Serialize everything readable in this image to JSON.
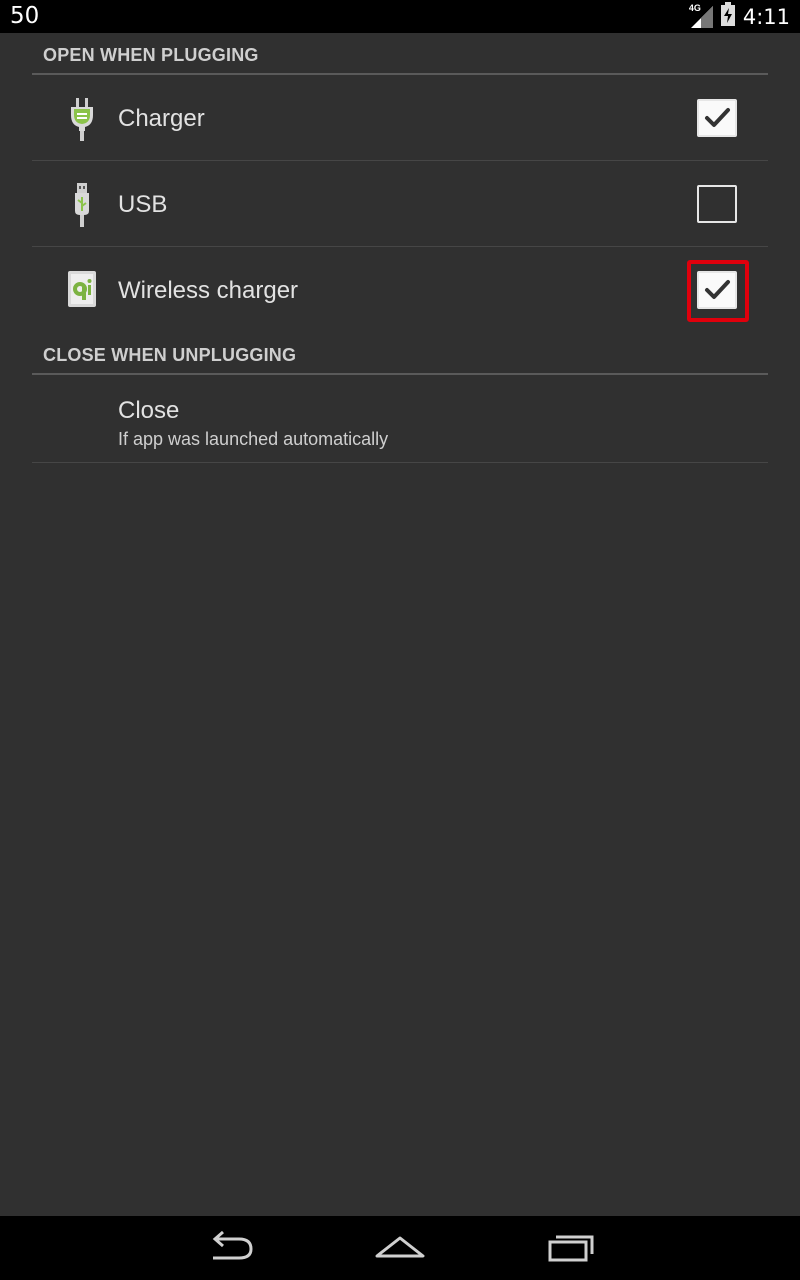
{
  "status_bar": {
    "left_text": "50",
    "network": "4G",
    "time": "4:11",
    "icons": [
      "signal-icon",
      "battery-charging-icon"
    ]
  },
  "sections": [
    {
      "header": "OPEN WHEN PLUGGING",
      "items": [
        {
          "label": "Charger",
          "icon": "charger-plug-icon",
          "checked": true
        },
        {
          "label": "USB",
          "icon": "usb-plug-icon",
          "checked": false
        },
        {
          "label": "Wireless charger",
          "icon": "qi-wireless-icon",
          "checked": true,
          "highlighted": true
        }
      ]
    },
    {
      "header": "CLOSE WHEN UNPLUGGING",
      "items": [
        {
          "title": "Close",
          "summary": "If app was launched automatically"
        }
      ]
    }
  ],
  "nav_bar": {
    "icons": [
      "back-icon",
      "home-icon",
      "recent-apps-icon"
    ]
  },
  "colors": {
    "background": "#303030",
    "accent_green": "#8bc34a",
    "highlight": "#e0000c"
  }
}
